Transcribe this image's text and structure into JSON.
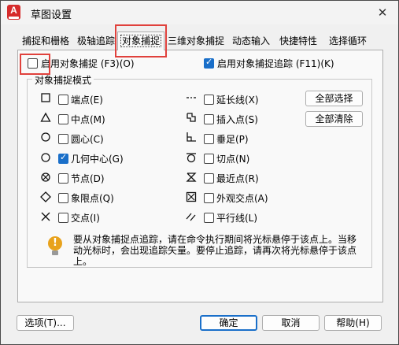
{
  "window": {
    "title": "草图设置",
    "close_glyph": "✕"
  },
  "tabs": [
    "捕捉和栅格",
    "极轴追踪",
    "对象捕捉",
    "三维对象捕捉",
    "动态输入",
    "快捷特性",
    "选择循环"
  ],
  "options": {
    "osnap_on": {
      "label": "启用对象捕捉 (F3)(O)",
      "checked": false
    },
    "otrack_on": {
      "label": "启用对象捕捉追踪 (F11)(K)",
      "checked": true
    }
  },
  "group": {
    "title": "对象捕捉模式"
  },
  "snap_modes_left": [
    {
      "symbol": "endpoint-icon",
      "label": "端点(E)",
      "checked": false
    },
    {
      "symbol": "midpoint-icon",
      "label": "中点(M)",
      "checked": false
    },
    {
      "symbol": "center-icon",
      "label": "圆心(C)",
      "checked": false
    },
    {
      "symbol": "geometric-center-icon",
      "label": "几何中心(G)",
      "checked": true
    },
    {
      "symbol": "node-icon",
      "label": "节点(D)",
      "checked": false
    },
    {
      "symbol": "quadrant-icon",
      "label": "象限点(Q)",
      "checked": false
    },
    {
      "symbol": "intersection-icon",
      "label": "交点(I)",
      "checked": false
    }
  ],
  "snap_modes_right": [
    {
      "symbol": "extension-icon",
      "label": "延长线(X)",
      "checked": false
    },
    {
      "symbol": "insertion-icon",
      "label": "插入点(S)",
      "checked": false
    },
    {
      "symbol": "perpendicular-icon",
      "label": "垂足(P)",
      "checked": false
    },
    {
      "symbol": "tangent-icon",
      "label": "切点(N)",
      "checked": false
    },
    {
      "symbol": "nearest-icon",
      "label": "最近点(R)",
      "checked": false
    },
    {
      "symbol": "apparent-intersection-icon",
      "label": "外观交点(A)",
      "checked": false
    },
    {
      "symbol": "parallel-icon",
      "label": "平行线(L)",
      "checked": false
    }
  ],
  "buttons": {
    "select_all": "全部选择",
    "clear_all": "全部清除",
    "options": "选项(T)...",
    "ok": "确定",
    "cancel": "取消",
    "help": "帮助(H)"
  },
  "note": "要从对象捕捉点追踪，请在命令执行期间将光标悬停于该点上。当移动光标时，会出现追踪矢量。要停止追踪，请再次将光标悬停于该点上。",
  "warn_glyph": "!",
  "app_icon_letter": "A"
}
